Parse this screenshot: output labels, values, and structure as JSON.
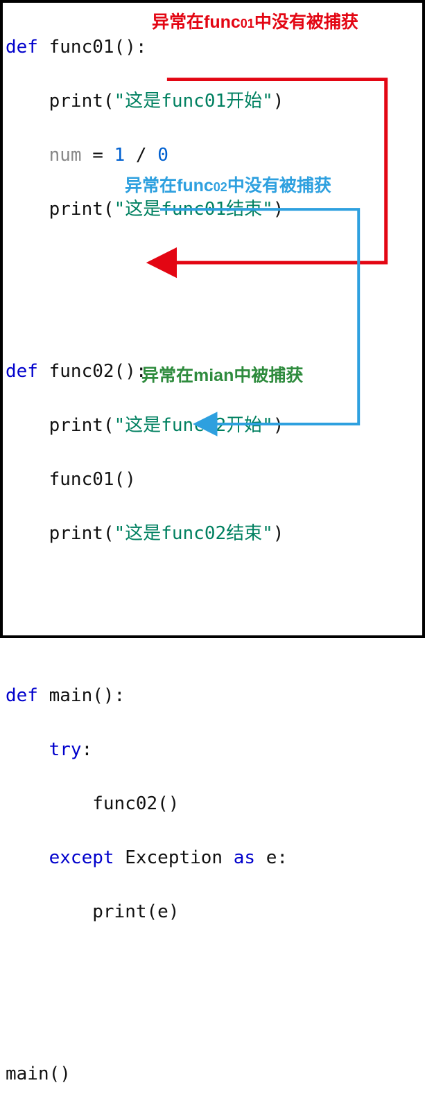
{
  "code": {
    "l1": {
      "def": "def",
      "name": "func01",
      "paren": "():"
    },
    "l2": {
      "indent": "    ",
      "fn": "print",
      "open": "(",
      "str": "\"这是func01开始\"",
      "close": ")"
    },
    "l3": {
      "indent": "    ",
      "var": "num",
      "eq": " = ",
      "n1": "1",
      "div": " / ",
      "n2": "0"
    },
    "l4": {
      "indent": "    ",
      "fn": "print",
      "open": "(",
      "str": "\"这是func01结束\"",
      "close": ")"
    },
    "l7": {
      "def": "def",
      "name": "func02",
      "paren": "():"
    },
    "l8": {
      "indent": "    ",
      "fn": "print",
      "open": "(",
      "str": "\"这是func02开始\"",
      "close": ")"
    },
    "l9": {
      "indent": "    ",
      "call": "func01()"
    },
    "l10": {
      "indent": "    ",
      "fn": "print",
      "open": "(",
      "str": "\"这是func02结束\"",
      "close": ")"
    },
    "l13": {
      "def": "def",
      "name": "main",
      "paren": "():"
    },
    "l14": {
      "indent": "    ",
      "kw": "try",
      "colon": ":"
    },
    "l15": {
      "indent": "        ",
      "call": "func02()"
    },
    "l16": {
      "indent": "    ",
      "kw1": "except",
      "sp1": " ",
      "cls": "Exception",
      "sp2": " ",
      "kw2": "as",
      "sp3": " ",
      "var": "e",
      "colon": ":"
    },
    "l17": {
      "indent": "        ",
      "fn": "print",
      "open": "(",
      "arg": "e",
      "close": ")"
    },
    "l20": {
      "call": "main()"
    }
  },
  "annotations": {
    "red_prefix": "异常在func",
    "red_sub": "01",
    "red_suffix": "中没有被捕获",
    "blue_prefix": "异常在func",
    "blue_sub": "02",
    "blue_suffix": "中没有被捕获",
    "green_prefix": "异常在mian中被捕获"
  }
}
